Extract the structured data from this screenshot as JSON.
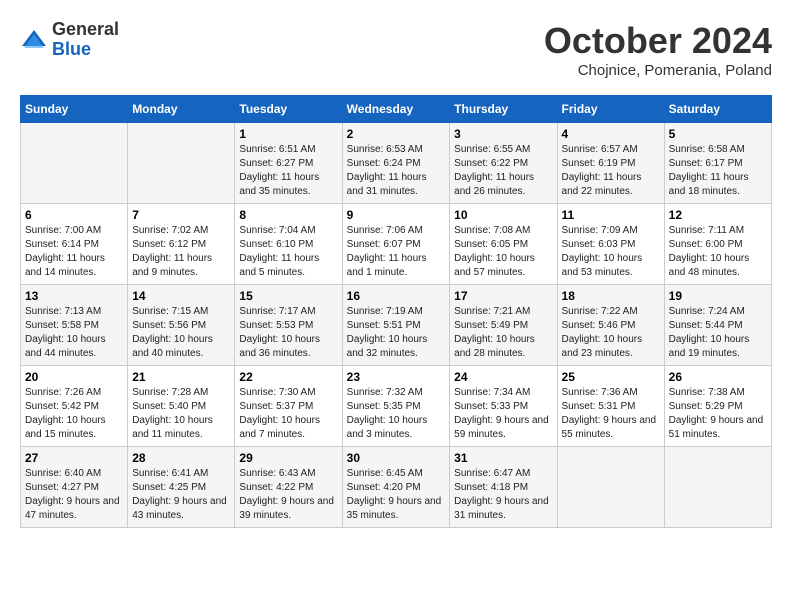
{
  "header": {
    "logo_general": "General",
    "logo_blue": "Blue",
    "month_title": "October 2024",
    "subtitle": "Chojnice, Pomerania, Poland"
  },
  "days_of_week": [
    "Sunday",
    "Monday",
    "Tuesday",
    "Wednesday",
    "Thursday",
    "Friday",
    "Saturday"
  ],
  "weeks": [
    [
      {
        "day": "",
        "info": ""
      },
      {
        "day": "",
        "info": ""
      },
      {
        "day": "1",
        "info": "Sunrise: 6:51 AM\nSunset: 6:27 PM\nDaylight: 11 hours and 35 minutes."
      },
      {
        "day": "2",
        "info": "Sunrise: 6:53 AM\nSunset: 6:24 PM\nDaylight: 11 hours and 31 minutes."
      },
      {
        "day": "3",
        "info": "Sunrise: 6:55 AM\nSunset: 6:22 PM\nDaylight: 11 hours and 26 minutes."
      },
      {
        "day": "4",
        "info": "Sunrise: 6:57 AM\nSunset: 6:19 PM\nDaylight: 11 hours and 22 minutes."
      },
      {
        "day": "5",
        "info": "Sunrise: 6:58 AM\nSunset: 6:17 PM\nDaylight: 11 hours and 18 minutes."
      }
    ],
    [
      {
        "day": "6",
        "info": "Sunrise: 7:00 AM\nSunset: 6:14 PM\nDaylight: 11 hours and 14 minutes."
      },
      {
        "day": "7",
        "info": "Sunrise: 7:02 AM\nSunset: 6:12 PM\nDaylight: 11 hours and 9 minutes."
      },
      {
        "day": "8",
        "info": "Sunrise: 7:04 AM\nSunset: 6:10 PM\nDaylight: 11 hours and 5 minutes."
      },
      {
        "day": "9",
        "info": "Sunrise: 7:06 AM\nSunset: 6:07 PM\nDaylight: 11 hours and 1 minute."
      },
      {
        "day": "10",
        "info": "Sunrise: 7:08 AM\nSunset: 6:05 PM\nDaylight: 10 hours and 57 minutes."
      },
      {
        "day": "11",
        "info": "Sunrise: 7:09 AM\nSunset: 6:03 PM\nDaylight: 10 hours and 53 minutes."
      },
      {
        "day": "12",
        "info": "Sunrise: 7:11 AM\nSunset: 6:00 PM\nDaylight: 10 hours and 48 minutes."
      }
    ],
    [
      {
        "day": "13",
        "info": "Sunrise: 7:13 AM\nSunset: 5:58 PM\nDaylight: 10 hours and 44 minutes."
      },
      {
        "day": "14",
        "info": "Sunrise: 7:15 AM\nSunset: 5:56 PM\nDaylight: 10 hours and 40 minutes."
      },
      {
        "day": "15",
        "info": "Sunrise: 7:17 AM\nSunset: 5:53 PM\nDaylight: 10 hours and 36 minutes."
      },
      {
        "day": "16",
        "info": "Sunrise: 7:19 AM\nSunset: 5:51 PM\nDaylight: 10 hours and 32 minutes."
      },
      {
        "day": "17",
        "info": "Sunrise: 7:21 AM\nSunset: 5:49 PM\nDaylight: 10 hours and 28 minutes."
      },
      {
        "day": "18",
        "info": "Sunrise: 7:22 AM\nSunset: 5:46 PM\nDaylight: 10 hours and 23 minutes."
      },
      {
        "day": "19",
        "info": "Sunrise: 7:24 AM\nSunset: 5:44 PM\nDaylight: 10 hours and 19 minutes."
      }
    ],
    [
      {
        "day": "20",
        "info": "Sunrise: 7:26 AM\nSunset: 5:42 PM\nDaylight: 10 hours and 15 minutes."
      },
      {
        "day": "21",
        "info": "Sunrise: 7:28 AM\nSunset: 5:40 PM\nDaylight: 10 hours and 11 minutes."
      },
      {
        "day": "22",
        "info": "Sunrise: 7:30 AM\nSunset: 5:37 PM\nDaylight: 10 hours and 7 minutes."
      },
      {
        "day": "23",
        "info": "Sunrise: 7:32 AM\nSunset: 5:35 PM\nDaylight: 10 hours and 3 minutes."
      },
      {
        "day": "24",
        "info": "Sunrise: 7:34 AM\nSunset: 5:33 PM\nDaylight: 9 hours and 59 minutes."
      },
      {
        "day": "25",
        "info": "Sunrise: 7:36 AM\nSunset: 5:31 PM\nDaylight: 9 hours and 55 minutes."
      },
      {
        "day": "26",
        "info": "Sunrise: 7:38 AM\nSunset: 5:29 PM\nDaylight: 9 hours and 51 minutes."
      }
    ],
    [
      {
        "day": "27",
        "info": "Sunrise: 6:40 AM\nSunset: 4:27 PM\nDaylight: 9 hours and 47 minutes."
      },
      {
        "day": "28",
        "info": "Sunrise: 6:41 AM\nSunset: 4:25 PM\nDaylight: 9 hours and 43 minutes."
      },
      {
        "day": "29",
        "info": "Sunrise: 6:43 AM\nSunset: 4:22 PM\nDaylight: 9 hours and 39 minutes."
      },
      {
        "day": "30",
        "info": "Sunrise: 6:45 AM\nSunset: 4:20 PM\nDaylight: 9 hours and 35 minutes."
      },
      {
        "day": "31",
        "info": "Sunrise: 6:47 AM\nSunset: 4:18 PM\nDaylight: 9 hours and 31 minutes."
      },
      {
        "day": "",
        "info": ""
      },
      {
        "day": "",
        "info": ""
      }
    ]
  ]
}
